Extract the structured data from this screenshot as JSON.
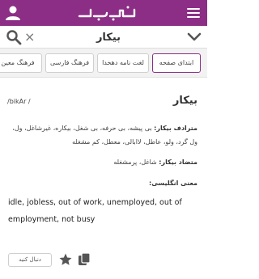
{
  "header": {
    "logo_icon": "abadis-logo",
    "menu_icon": "hamburger-menu-icon",
    "user_icon": "user-icon",
    "brand_color": "#8c2e86"
  },
  "search": {
    "value": "بیکار",
    "clear_label": "×",
    "search_icon": "search-icon",
    "expand_icon": "chevron-down-icon"
  },
  "tabs": [
    {
      "label": "ابتدای صفحه"
    },
    {
      "label": "لغت نامه دهخدا"
    },
    {
      "label": "فرهنگ فارسی"
    },
    {
      "label": "فرهنگ معین"
    }
  ],
  "entry": {
    "word": "بیکار",
    "pronunciation": "/bikAr /",
    "synonyms_label": "مترادف بیکار:",
    "synonyms_text": "بی پیشه، بی حرفه، بی شغل، بیکاره، غیرشاغل، ول، ول گرد، ولو، عاطل، لاابالی، معطل، کم مشغله",
    "antonyms_label": "متضاد بیکار:",
    "antonyms_text": "شاغل، پرمشغله",
    "english_label": "معنی انگلیسی:",
    "english_text": "idle, jobless, out of work, unemployed, out of employment, not busy"
  },
  "actions": {
    "follow_label": "دنبال کنید",
    "star_icon": "star-icon",
    "copy_icon": "copy-icon"
  }
}
